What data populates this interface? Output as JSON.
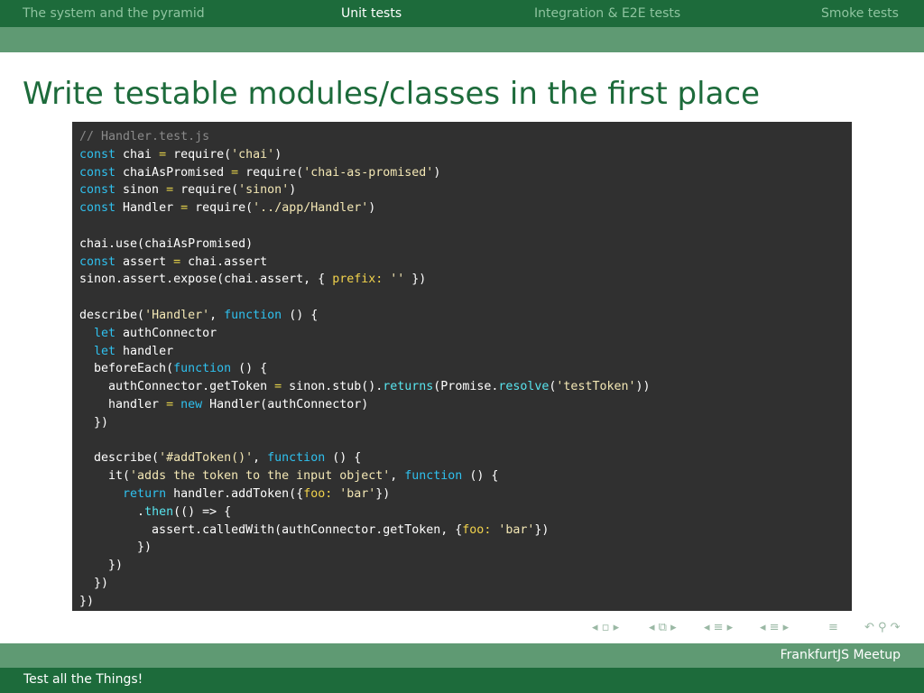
{
  "nav": {
    "items": [
      {
        "label": "The system and the pyramid",
        "active": false
      },
      {
        "label": "Unit tests",
        "active": true
      },
      {
        "label": "Integration & E2E tests",
        "active": false
      },
      {
        "label": "Smoke tests",
        "active": false
      }
    ]
  },
  "frame": {
    "title": "Write testable modules/classes in the first place"
  },
  "code": {
    "lines": [
      [
        {
          "t": "// Handler.test.js",
          "c": "cm"
        }
      ],
      [
        {
          "t": "const",
          "c": "kw"
        },
        {
          "t": " chai ",
          "c": "tx"
        },
        {
          "t": "=",
          "c": "op"
        },
        {
          "t": " require(",
          "c": "tx"
        },
        {
          "t": "'chai'",
          "c": "st"
        },
        {
          "t": ")",
          "c": "tx"
        }
      ],
      [
        {
          "t": "const",
          "c": "kw"
        },
        {
          "t": " chaiAsPromised ",
          "c": "tx"
        },
        {
          "t": "=",
          "c": "op"
        },
        {
          "t": " require(",
          "c": "tx"
        },
        {
          "t": "'chai-as-promised'",
          "c": "st"
        },
        {
          "t": ")",
          "c": "tx"
        }
      ],
      [
        {
          "t": "const",
          "c": "kw"
        },
        {
          "t": " sinon ",
          "c": "tx"
        },
        {
          "t": "=",
          "c": "op"
        },
        {
          "t": " require(",
          "c": "tx"
        },
        {
          "t": "'sinon'",
          "c": "st"
        },
        {
          "t": ")",
          "c": "tx"
        }
      ],
      [
        {
          "t": "const",
          "c": "kw"
        },
        {
          "t": " Handler ",
          "c": "tx"
        },
        {
          "t": "=",
          "c": "op"
        },
        {
          "t": " require(",
          "c": "tx"
        },
        {
          "t": "'../app/Handler'",
          "c": "st"
        },
        {
          "t": ")",
          "c": "tx"
        }
      ],
      [],
      [
        {
          "t": "chai.use(chaiAsPromised)",
          "c": "tx"
        }
      ],
      [
        {
          "t": "const",
          "c": "kw"
        },
        {
          "t": " assert ",
          "c": "tx"
        },
        {
          "t": "=",
          "c": "op"
        },
        {
          "t": " chai.assert",
          "c": "tx"
        }
      ],
      [
        {
          "t": "sinon.assert.expose(chai.assert, { ",
          "c": "tx"
        },
        {
          "t": "prefix:",
          "c": "pr"
        },
        {
          "t": " ",
          "c": "tx"
        },
        {
          "t": "''",
          "c": "st"
        },
        {
          "t": " })",
          "c": "tx"
        }
      ],
      [],
      [
        {
          "t": "describe(",
          "c": "tx"
        },
        {
          "t": "'Handler'",
          "c": "st"
        },
        {
          "t": ", ",
          "c": "tx"
        },
        {
          "t": "function",
          "c": "kw"
        },
        {
          "t": " () {",
          "c": "tx"
        }
      ],
      [
        {
          "t": "  ",
          "c": "tx"
        },
        {
          "t": "let",
          "c": "kw"
        },
        {
          "t": " authConnector",
          "c": "tx"
        }
      ],
      [
        {
          "t": "  ",
          "c": "tx"
        },
        {
          "t": "let",
          "c": "kw"
        },
        {
          "t": " handler",
          "c": "tx"
        }
      ],
      [
        {
          "t": "  beforeEach(",
          "c": "tx"
        },
        {
          "t": "function",
          "c": "kw"
        },
        {
          "t": " () {",
          "c": "tx"
        }
      ],
      [
        {
          "t": "    authConnector.getToken ",
          "c": "tx"
        },
        {
          "t": "=",
          "c": "op"
        },
        {
          "t": " sinon.stub().",
          "c": "tx"
        },
        {
          "t": "returns",
          "c": "fn"
        },
        {
          "t": "(Promise.",
          "c": "tx"
        },
        {
          "t": "resolve",
          "c": "fn"
        },
        {
          "t": "(",
          "c": "tx"
        },
        {
          "t": "'testToken'",
          "c": "st"
        },
        {
          "t": "))",
          "c": "tx"
        }
      ],
      [
        {
          "t": "    handler ",
          "c": "tx"
        },
        {
          "t": "=",
          "c": "op"
        },
        {
          "t": " ",
          "c": "tx"
        },
        {
          "t": "new",
          "c": "kw"
        },
        {
          "t": " Handler(authConnector)",
          "c": "tx"
        }
      ],
      [
        {
          "t": "  })",
          "c": "tx"
        }
      ],
      [],
      [
        {
          "t": "  describe(",
          "c": "tx"
        },
        {
          "t": "'#addToken()'",
          "c": "st"
        },
        {
          "t": ", ",
          "c": "tx"
        },
        {
          "t": "function",
          "c": "kw"
        },
        {
          "t": " () {",
          "c": "tx"
        }
      ],
      [
        {
          "t": "    it(",
          "c": "tx"
        },
        {
          "t": "'adds the token to the input object'",
          "c": "st"
        },
        {
          "t": ", ",
          "c": "tx"
        },
        {
          "t": "function",
          "c": "kw"
        },
        {
          "t": " () {",
          "c": "tx"
        }
      ],
      [
        {
          "t": "      ",
          "c": "tx"
        },
        {
          "t": "return",
          "c": "kw"
        },
        {
          "t": " handler.addToken({",
          "c": "tx"
        },
        {
          "t": "foo:",
          "c": "pr"
        },
        {
          "t": " ",
          "c": "tx"
        },
        {
          "t": "'bar'",
          "c": "st"
        },
        {
          "t": "})",
          "c": "tx"
        }
      ],
      [
        {
          "t": "        .",
          "c": "tx"
        },
        {
          "t": "then",
          "c": "fn"
        },
        {
          "t": "(() => {",
          "c": "tx"
        }
      ],
      [
        {
          "t": "          assert.calledWith(authConnector.getToken, {",
          "c": "tx"
        },
        {
          "t": "foo:",
          "c": "pr"
        },
        {
          "t": " ",
          "c": "tx"
        },
        {
          "t": "'bar'",
          "c": "st"
        },
        {
          "t": "})",
          "c": "tx"
        }
      ],
      [
        {
          "t": "        })",
          "c": "tx"
        }
      ],
      [
        {
          "t": "    })",
          "c": "tx"
        }
      ],
      [
        {
          "t": "  })",
          "c": "tx"
        }
      ],
      [
        {
          "t": "})",
          "c": "tx"
        }
      ]
    ]
  },
  "nav_symbols": [
    {
      "name": "frame-nav-icon"
    },
    {
      "name": "subsection-nav-icon"
    },
    {
      "name": "section-nav-icon"
    },
    {
      "name": "subsection-list-nav-icon"
    },
    {
      "name": "document-nav-icon"
    },
    {
      "name": "search-back-forward-icon"
    }
  ],
  "footer": {
    "event": "FrankfurtJS Meetup",
    "title": "Test all the Things!"
  },
  "colors": {
    "theme_dark": "#1d6b3b",
    "theme_mid": "#5f9a73",
    "code_bg": "#303030"
  }
}
